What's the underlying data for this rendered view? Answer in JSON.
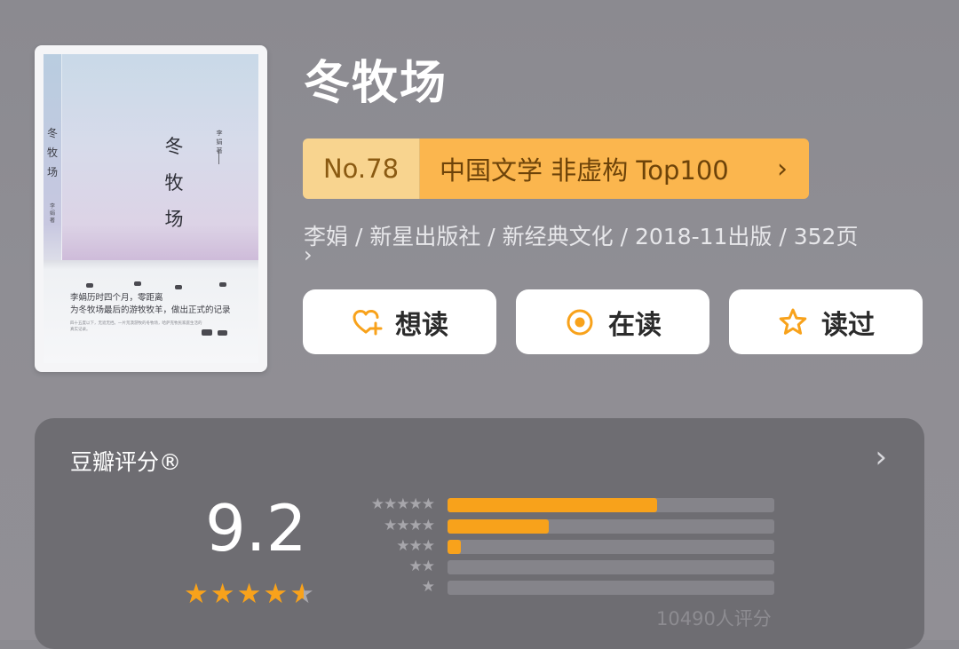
{
  "book": {
    "title": "冬牧场",
    "cover": {
      "title_vertical": "冬\n牧\n场",
      "spine_title": "冬\n牧\n场",
      "author_vertical": "李\n娟\n著",
      "spine_author": "李\n娟\n著",
      "blurb": "李娟历时四个月，零距离\n为冬牧场最后的游牧牧羊，做出正式的记录",
      "small_text": "四十五度以下，无遮无挡。一片荒漠游牧的冬牧场，哈萨克牧民家庭生活的真实记录。"
    },
    "rank": {
      "number": "No.78",
      "label": "中国文学 非虚构 Top100",
      "chevron": "›"
    },
    "meta": "李娟 / 新星出版社 / 新经典文化 / 2018-11出版 / 352页",
    "meta_chevron": "›"
  },
  "actions": {
    "want": {
      "label": "想读",
      "icon": "heart-plus-icon"
    },
    "reading": {
      "label": "在读",
      "icon": "target-circle-icon"
    },
    "read": {
      "label": "读过",
      "icon": "star-outline-icon"
    }
  },
  "rating": {
    "title": "豆瓣评分®",
    "chevron": "›",
    "score": "9.2",
    "stars_value": 4.6,
    "distribution": [
      {
        "stars": 5,
        "label": "★★★★★",
        "fraction": 0.64
      },
      {
        "stars": 4,
        "label": "★★★★",
        "fraction": 0.31
      },
      {
        "stars": 3,
        "label": "★★★",
        "fraction": 0.04
      },
      {
        "stars": 2,
        "label": "★★",
        "fraction": 0.0
      },
      {
        "stars": 1,
        "label": "★",
        "fraction": 0.0
      }
    ],
    "count": "10490人评分"
  },
  "colors": {
    "accent": "#f8a21b",
    "rank_number_bg": "#f8d48f",
    "rank_label_bg": "#fbb64e",
    "panel_bg": "#6e6d72"
  }
}
